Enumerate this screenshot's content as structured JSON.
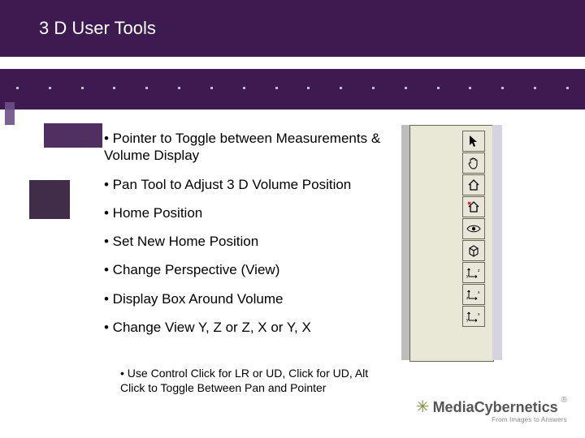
{
  "title": "3 D User Tools",
  "bullets": [
    "• Pointer to Toggle between Measurements & Volume Display",
    "• Pan Tool to Adjust 3 D Volume Position",
    "• Home Position",
    "• Set New Home Position",
    "• Change Perspective (View)",
    "• Display Box Around Volume",
    "• Change View Y, Z or Z, X or Y, X"
  ],
  "note": "• Use Control Click for LR or UD, Click for UD, Alt Click to Toggle Between Pan and Pointer",
  "toolbar_items": [
    {
      "name": "pointer-tool",
      "icon": "pointer"
    },
    {
      "name": "pan-tool",
      "icon": "hand"
    },
    {
      "name": "home-tool",
      "icon": "home"
    },
    {
      "name": "set-home-tool",
      "icon": "home-set"
    },
    {
      "name": "perspective-tool",
      "icon": "eye"
    },
    {
      "name": "box-tool",
      "icon": "cube"
    },
    {
      "name": "view-yz-tool",
      "icon": "axis",
      "label": "z"
    },
    {
      "name": "view-zx-tool",
      "icon": "axis",
      "label": "x"
    },
    {
      "name": "view-yx-tool",
      "icon": "axis",
      "label": "x"
    }
  ],
  "brand": {
    "name": "MediaCybernetics",
    "tagline": "From Images to Answers"
  },
  "colors": {
    "header_bg": "#3d1a4f",
    "accent1": "#5a3a6e",
    "accent2": "#2f1a3e",
    "accent3": "#7a5a8a",
    "toolbar_bg": "#e9e7d6"
  }
}
